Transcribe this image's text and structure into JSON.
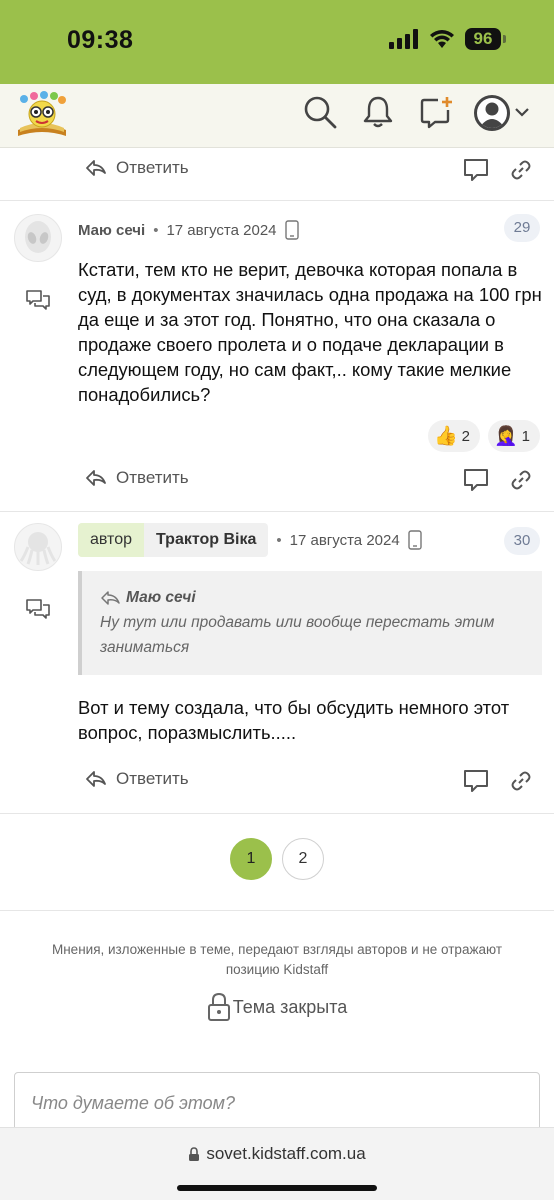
{
  "status_bar": {
    "time": "09:38",
    "battery": "96"
  },
  "colors": {
    "brand": "#9bc04b",
    "badge_bg": "#eef1f6"
  },
  "icons": [
    "site-logo",
    "search-icon",
    "bell-icon",
    "new-message-icon",
    "user-avatar",
    "chevron-down-icon",
    "reply-icon",
    "comment-icon",
    "link-icon",
    "chat-bubbles-icon",
    "mobile-icon",
    "lock-icon"
  ],
  "reply_label": "Ответить",
  "posts": [
    {
      "author": "Маю сечі",
      "date": "17 августа 2024",
      "number": "29",
      "text": "Кстати, тем кто не верит, девочка которая попала в суд, в документах значилась одна продажа на 100 грн да еще и за этот год. Понятно, что она сказала о продаже своего пролета и о подаче декларации в следующем году, но сам факт,.. кому такие мелкие понадобились?",
      "reactions": [
        {
          "emoji": "👍",
          "count": "2"
        },
        {
          "emoji": "🤦‍♀️",
          "count": "1"
        }
      ]
    },
    {
      "role": "автор",
      "author": "Трактор Віка",
      "date": "17 августа 2024",
      "number": "30",
      "quote_author": "Маю сечі",
      "quote_text": "Ну тут или продавать или вообще перестать этим заниматься",
      "text": "Вот и тему создала, что бы обсудить немного этот вопрос, поразмыслить....."
    }
  ],
  "pagination": {
    "pages": [
      "1",
      "2"
    ],
    "current": "1"
  },
  "disclaimer": "Мнения, изложенные в теме, передают взгляды авторов и не отражают позицию Kidstaff",
  "locked_text": "Тема закрыта",
  "comment_placeholder": "Что думаете об этом?",
  "url": "sovet.kidstaff.com.ua"
}
